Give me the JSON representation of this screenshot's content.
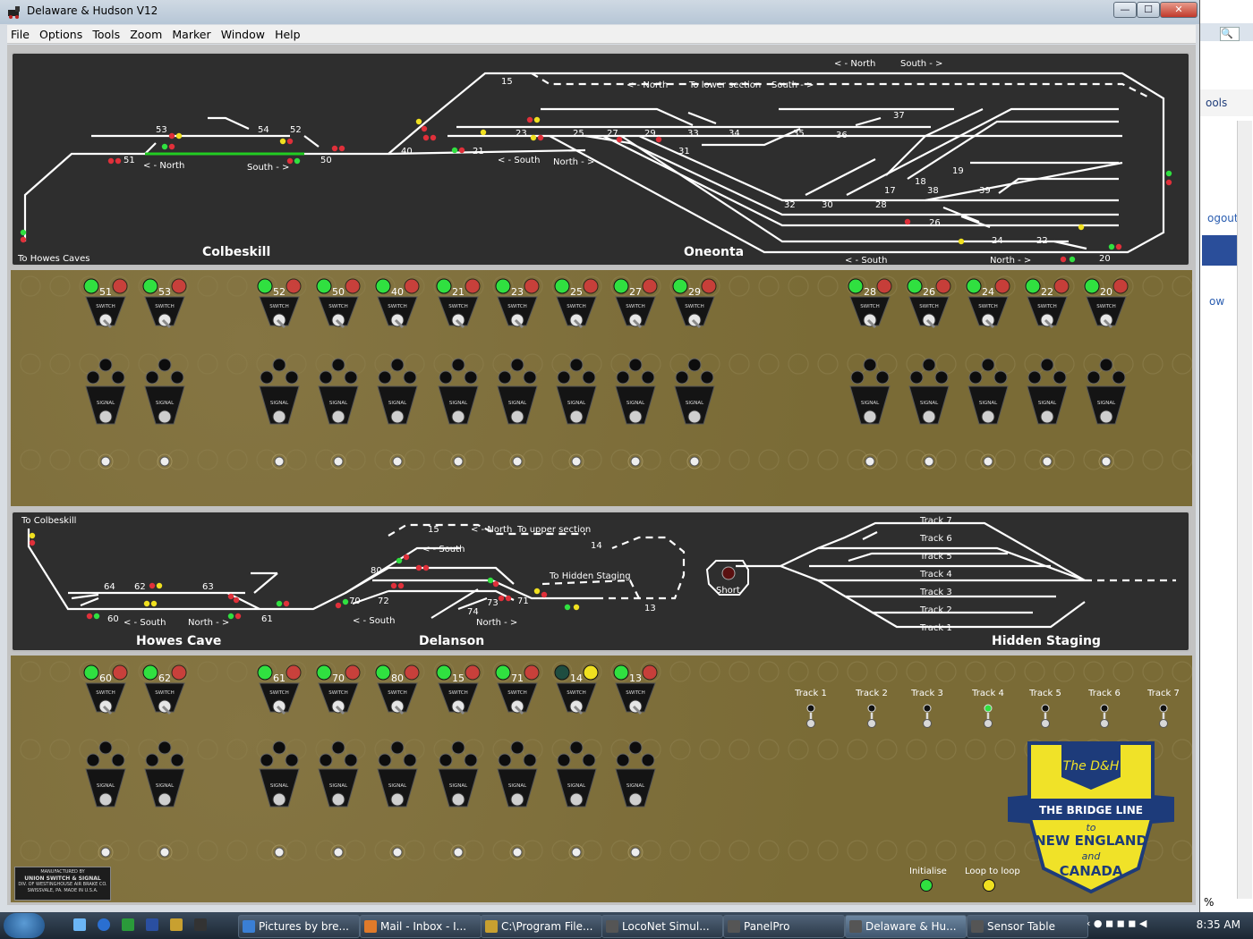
{
  "window": {
    "title": "Delaware & Hudson V12",
    "min": "—",
    "max": "☐",
    "close": "✕"
  },
  "menu": [
    "File",
    "Options",
    "Tools",
    "Zoom",
    "Marker",
    "Window",
    "Help"
  ],
  "upper_panel": {
    "labels": {
      "colbeskill": "Colbeskill",
      "oneonta": "Oneonta",
      "to_howes_caves": "To Howes Caves",
      "north_left": "< - North",
      "south_right": "South - >",
      "north_top": "< - North",
      "south_top": "South - >",
      "north_lower": "< - North",
      "to_lower": "To lower section",
      "south_lower": "South - >",
      "south_mid": "< - South",
      "north_mid": "North - >",
      "south_bot": "< - South",
      "north_bot": "North - >"
    },
    "track_numbers": [
      "15",
      "53",
      "54",
      "52",
      "51",
      "50",
      "40",
      "21",
      "23",
      "25",
      "27",
      "29",
      "33",
      "34",
      "31",
      "35",
      "36",
      "37",
      "19",
      "18",
      "17",
      "38",
      "39",
      "32",
      "30",
      "28",
      "26",
      "24",
      "22",
      "20"
    ]
  },
  "upper_controls": {
    "switch_label": "SWITCH",
    "signal_label": "SIGNAL",
    "switches_left": [
      "51",
      "53",
      "52",
      "50",
      "40",
      "21",
      "23",
      "25",
      "27",
      "29"
    ],
    "switches_right": [
      "28",
      "26",
      "24",
      "22",
      "20"
    ]
  },
  "lower_panel": {
    "labels": {
      "to_colbeskill": "To Colbeskill",
      "howes_cave": "Howes Cave",
      "delanson": "Delanson",
      "hidden_staging": "Hidden Staging",
      "south_left": "< - South",
      "north_left": "North - >",
      "north_top": "< - North",
      "to_upper": "To upper section",
      "south_top": "< - South",
      "to_hidden": "To Hidden Staging",
      "south_mid": "< - South",
      "north_mid": "North - >",
      "short": "Short"
    },
    "track_numbers": [
      "64",
      "62",
      "63",
      "60",
      "61",
      "15",
      "14",
      "80",
      "70",
      "72",
      "73",
      "71",
      "74",
      "13"
    ],
    "staging_tracks": [
      "Track 7",
      "Track 6",
      "Track 5",
      "Track 4",
      "Track 3",
      "Track 2",
      "Track 1"
    ]
  },
  "lower_controls": {
    "switches": [
      "60",
      "62",
      "61",
      "70",
      "80",
      "15",
      "71",
      "14",
      "13"
    ],
    "track_toggles": [
      "Track 1",
      "Track 2",
      "Track 3",
      "Track 4",
      "Track 5",
      "Track 6",
      "Track 7"
    ],
    "initialise": "Initialise",
    "loop_to_loop": "Loop to loop",
    "maker": [
      "MANUFACTURED BY",
      "UNION SWITCH & SIGNAL",
      "DIV. OF WESTINGHOUSE AIR BRAKE CO.",
      "SWISSVALE, PA.     MADE IN U.S.A."
    ]
  },
  "logo": {
    "script": "The D&H",
    "line": "THE BRIDGE LINE",
    "to": "to",
    "ne": "NEW ENGLAND",
    "and": "and",
    "canada": "CANADA"
  },
  "right_window": {
    "logout": "ogout",
    "tools": "ools",
    "low": "ow",
    "percent": "%"
  },
  "taskbar": {
    "items": [
      "Pictures by bre...",
      "Mail - Inbox - I...",
      "C:\\Program File...",
      "LocoNet Simul...",
      "PanelPro",
      "Delaware & Hu...",
      "Sensor Table"
    ],
    "clock": "8:35 AM"
  },
  "colors": {
    "track": "#ffffff",
    "occupied": "#22cc22",
    "panel": "#2e2e2e",
    "brass": "#7a6b36",
    "led_red": "#e0303a",
    "led_green": "#30e040",
    "led_yellow": "#f0e020"
  }
}
